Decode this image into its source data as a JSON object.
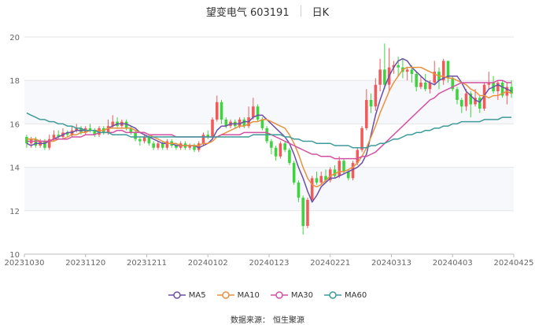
{
  "header": {
    "stock_name": "望变电气 603191",
    "period": "日K"
  },
  "source": {
    "label": "数据来源：",
    "value": "恒生聚源"
  },
  "colors": {
    "up": "#f15a5a",
    "down": "#3dd43d",
    "ma5": "#6c4fa6",
    "ma10": "#e8913e",
    "ma30": "#d450a2",
    "ma60": "#3f9a9a",
    "grid_band": "#f7f8fb",
    "axis": "#999999"
  },
  "chart_data": {
    "type": "candlestick",
    "x_tick_labels": [
      "20231030",
      "20231120",
      "20231211",
      "20240102",
      "20240123",
      "20240221",
      "20240313",
      "20240403",
      "20240425"
    ],
    "y_ticks": [
      10,
      12,
      14,
      16,
      18,
      20
    ],
    "ylim": [
      10,
      20
    ],
    "legend": [
      {
        "key": "ma5",
        "label": "MA5"
      },
      {
        "key": "ma10",
        "label": "MA10"
      },
      {
        "key": "ma30",
        "label": "MA30"
      },
      {
        "key": "ma60",
        "label": "MA60"
      }
    ],
    "candles": [
      [
        15.4,
        15.1,
        15.5,
        14.9
      ],
      [
        15.1,
        15.3,
        15.4,
        14.9
      ],
      [
        15.3,
        15.0,
        15.4,
        14.9
      ],
      [
        15.0,
        15.2,
        15.3,
        14.9
      ],
      [
        15.2,
        14.9,
        15.3,
        14.8
      ],
      [
        14.9,
        15.3,
        15.5,
        14.8
      ],
      [
        15.3,
        15.5,
        15.7,
        15.2
      ],
      [
        15.5,
        15.4,
        15.7,
        15.3
      ],
      [
        15.4,
        15.6,
        15.8,
        15.3
      ],
      [
        15.6,
        15.5,
        15.7,
        15.4
      ],
      [
        15.5,
        15.7,
        15.9,
        15.4
      ],
      [
        15.7,
        15.8,
        16.0,
        15.6
      ],
      [
        15.8,
        15.6,
        15.9,
        15.5
      ],
      [
        15.6,
        15.8,
        15.9,
        15.5
      ],
      [
        15.8,
        15.7,
        16.0,
        15.6
      ],
      [
        15.7,
        15.5,
        15.8,
        15.4
      ],
      [
        15.5,
        15.8,
        15.9,
        15.4
      ],
      [
        15.8,
        15.6,
        15.9,
        15.5
      ],
      [
        15.6,
        15.9,
        16.2,
        15.5
      ],
      [
        15.9,
        16.1,
        16.4,
        15.8
      ],
      [
        16.1,
        15.9,
        16.3,
        15.8
      ],
      [
        15.9,
        16.1,
        16.2,
        15.8
      ],
      [
        16.1,
        15.8,
        16.2,
        15.7
      ],
      [
        15.8,
        15.6,
        15.9,
        15.5
      ],
      [
        15.6,
        15.3,
        15.7,
        15.2
      ],
      [
        15.3,
        15.2,
        15.4,
        15.0
      ],
      [
        15.2,
        15.4,
        15.5,
        15.1
      ],
      [
        15.4,
        15.1,
        15.5,
        15.0
      ],
      [
        15.1,
        14.9,
        15.2,
        14.8
      ],
      [
        14.9,
        15.1,
        15.2,
        14.8
      ],
      [
        15.1,
        14.9,
        15.2,
        14.8
      ],
      [
        14.9,
        15.2,
        15.3,
        14.8
      ],
      [
        15.2,
        15.0,
        15.3,
        14.9
      ],
      [
        15.0,
        14.9,
        15.1,
        14.8
      ],
      [
        14.9,
        15.1,
        15.2,
        14.8
      ],
      [
        15.1,
        14.9,
        15.2,
        14.8
      ],
      [
        14.9,
        15.0,
        15.1,
        14.8
      ],
      [
        15.0,
        14.8,
        15.1,
        14.7
      ],
      [
        14.8,
        15.1,
        15.2,
        14.7
      ],
      [
        15.1,
        15.5,
        15.6,
        15.0
      ],
      [
        15.5,
        15.4,
        15.7,
        15.3
      ],
      [
        15.4,
        16.2,
        16.3,
        15.3
      ],
      [
        16.2,
        17.0,
        17.3,
        16.1
      ],
      [
        17.0,
        16.2,
        17.1,
        16.0
      ],
      [
        16.2,
        15.9,
        16.3,
        15.8
      ],
      [
        15.9,
        16.1,
        16.2,
        15.8
      ],
      [
        16.1,
        15.9,
        16.2,
        15.8
      ],
      [
        15.9,
        16.2,
        16.3,
        15.8
      ],
      [
        16.2,
        15.9,
        16.3,
        15.8
      ],
      [
        15.9,
        16.3,
        16.8,
        15.8
      ],
      [
        16.3,
        16.8,
        17.2,
        16.2
      ],
      [
        16.8,
        16.2,
        16.9,
        16.1
      ],
      [
        16.2,
        15.8,
        16.3,
        15.7
      ],
      [
        15.8,
        15.2,
        15.9,
        15.1
      ],
      [
        15.2,
        14.9,
        15.3,
        14.6
      ],
      [
        14.9,
        14.5,
        15.0,
        14.3
      ],
      [
        14.5,
        15.1,
        15.2,
        14.4
      ],
      [
        15.1,
        14.8,
        15.2,
        14.7
      ],
      [
        14.8,
        14.2,
        14.9,
        14.1
      ],
      [
        14.2,
        13.3,
        14.3,
        13.2
      ],
      [
        13.3,
        12.6,
        13.4,
        12.4
      ],
      [
        12.6,
        11.3,
        12.7,
        10.9
      ],
      [
        11.3,
        12.5,
        12.6,
        11.2
      ],
      [
        12.5,
        13.5,
        13.6,
        12.4
      ],
      [
        13.5,
        13.3,
        13.8,
        13.2
      ],
      [
        13.3,
        13.6,
        13.8,
        13.2
      ],
      [
        13.6,
        13.4,
        13.9,
        13.3
      ],
      [
        13.4,
        13.9,
        14.0,
        13.3
      ],
      [
        13.9,
        13.6,
        14.1,
        13.5
      ],
      [
        13.6,
        14.3,
        14.5,
        13.5
      ],
      [
        14.3,
        13.8,
        14.4,
        13.7
      ],
      [
        13.8,
        13.5,
        13.9,
        13.4
      ],
      [
        13.5,
        14.2,
        14.3,
        13.4
      ],
      [
        14.2,
        14.8,
        14.9,
        14.1
      ],
      [
        14.8,
        15.8,
        15.9,
        14.7
      ],
      [
        15.8,
        17.1,
        17.6,
        15.7
      ],
      [
        17.1,
        16.8,
        17.4,
        16.5
      ],
      [
        16.8,
        17.8,
        18.1,
        16.6
      ],
      [
        17.8,
        18.5,
        19.0,
        17.5
      ],
      [
        18.5,
        17.8,
        19.7,
        17.6
      ],
      [
        17.8,
        18.6,
        19.5,
        17.5
      ],
      [
        18.6,
        18.7,
        18.9,
        18.3
      ],
      [
        18.7,
        18.6,
        19.1,
        18.2
      ],
      [
        18.6,
        18.4,
        19.0,
        18.1
      ],
      [
        18.4,
        18.5,
        18.6,
        18.0
      ],
      [
        18.5,
        18.3,
        18.7,
        17.9
      ],
      [
        18.3,
        17.7,
        18.4,
        17.5
      ],
      [
        17.7,
        17.9,
        18.2,
        17.6
      ],
      [
        17.9,
        17.6,
        18.3,
        17.5
      ],
      [
        17.6,
        17.9,
        18.0,
        17.4
      ],
      [
        17.9,
        18.4,
        18.9,
        17.8
      ],
      [
        18.4,
        18.0,
        18.6,
        17.6
      ],
      [
        18.0,
        18.9,
        19.0,
        17.8
      ],
      [
        18.9,
        18.1,
        18.9,
        17.9
      ],
      [
        18.1,
        17.6,
        18.2,
        17.5
      ],
      [
        17.6,
        17.1,
        17.7,
        16.9
      ],
      [
        17.1,
        16.8,
        17.2,
        16.5
      ],
      [
        16.8,
        17.4,
        17.6,
        16.6
      ],
      [
        17.4,
        16.9,
        17.5,
        16.3
      ],
      [
        16.9,
        17.2,
        17.6,
        16.8
      ],
      [
        17.2,
        16.7,
        17.3,
        16.5
      ],
      [
        16.7,
        17.8,
        17.9,
        16.6
      ],
      [
        17.8,
        17.9,
        18.4,
        17.6
      ],
      [
        17.9,
        17.5,
        18.2,
        17.4
      ],
      [
        17.5,
        17.9,
        18.0,
        17.1
      ],
      [
        17.9,
        17.3,
        18.0,
        17.2
      ],
      [
        17.3,
        17.7,
        17.9,
        16.9
      ],
      [
        17.7,
        17.4,
        18.0,
        17.2
      ]
    ],
    "series": [
      {
        "key": "ma5",
        "name": "MA5",
        "values": [
          15.1,
          15.0,
          15.1,
          15.1,
          15.1,
          15.2,
          15.3,
          15.4,
          15.5,
          15.6,
          15.6,
          15.7,
          15.7,
          15.7,
          15.7,
          15.7,
          15.7,
          15.7,
          15.8,
          15.9,
          16.0,
          16.0,
          16.0,
          15.9,
          15.8,
          15.6,
          15.5,
          15.4,
          15.3,
          15.2,
          15.1,
          15.1,
          15.1,
          15.0,
          15.0,
          15.0,
          15.0,
          15.0,
          14.9,
          15.0,
          15.1,
          15.3,
          15.7,
          15.9,
          15.9,
          16.0,
          16.0,
          16.0,
          16.1,
          16.1,
          16.3,
          16.4,
          16.4,
          16.2,
          16.0,
          15.8,
          15.6,
          15.4,
          15.1,
          14.6,
          14.0,
          13.5,
          12.9,
          12.4,
          12.7,
          13.1,
          13.3,
          13.5,
          13.5,
          13.6,
          13.7,
          13.8,
          13.9,
          14.0,
          14.2,
          14.6,
          15.5,
          16.4,
          17.1,
          17.7,
          18.2,
          18.6,
          18.9,
          19.0,
          18.9,
          18.6,
          18.4,
          18.2,
          18.0,
          17.9,
          17.8,
          18.0,
          18.1,
          18.2,
          18.2,
          18.2,
          17.9,
          17.5,
          17.3,
          17.1,
          17.0,
          17.3,
          17.6,
          17.7,
          17.8,
          17.7,
          17.6,
          17.5
        ]
      },
      {
        "key": "ma10",
        "name": "MA10",
        "values": [
          15.3,
          15.3,
          15.3,
          15.2,
          15.2,
          15.2,
          15.2,
          15.3,
          15.3,
          15.4,
          15.5,
          15.5,
          15.6,
          15.6,
          15.7,
          15.7,
          15.7,
          15.7,
          15.8,
          15.8,
          15.8,
          15.8,
          15.8,
          15.8,
          15.7,
          15.6,
          15.6,
          15.5,
          15.4,
          15.3,
          15.2,
          15.1,
          15.1,
          15.1,
          15.0,
          15.0,
          15.0,
          15.0,
          15.0,
          15.1,
          15.1,
          15.2,
          15.4,
          15.5,
          15.6,
          15.7,
          15.8,
          15.9,
          15.9,
          16.0,
          16.1,
          16.1,
          16.2,
          16.2,
          16.1,
          16.0,
          15.9,
          15.8,
          15.5,
          15.1,
          14.6,
          14.0,
          13.5,
          13.2,
          13.1,
          13.2,
          13.4,
          13.6,
          13.7,
          13.8,
          13.8,
          13.9,
          14.0,
          14.2,
          14.5,
          14.9,
          15.4,
          15.9,
          16.5,
          17.0,
          17.5,
          17.9,
          18.2,
          18.5,
          18.6,
          18.6,
          18.6,
          18.6,
          18.5,
          18.4,
          18.3,
          18.2,
          18.2,
          18.1,
          18.1,
          18.0,
          17.9,
          17.8,
          17.6,
          17.5,
          17.3,
          17.3,
          17.2,
          17.3,
          17.3,
          17.4,
          17.5,
          17.4
        ]
      },
      {
        "key": "ma30",
        "name": "MA30",
        "values": [
          15.2,
          15.2,
          15.2,
          15.2,
          15.2,
          15.2,
          15.3,
          15.3,
          15.3,
          15.3,
          15.4,
          15.4,
          15.4,
          15.5,
          15.5,
          15.5,
          15.6,
          15.6,
          15.6,
          15.6,
          15.7,
          15.7,
          15.6,
          15.6,
          15.6,
          15.6,
          15.6,
          15.5,
          15.5,
          15.5,
          15.5,
          15.5,
          15.5,
          15.4,
          15.4,
          15.4,
          15.4,
          15.4,
          15.4,
          15.4,
          15.4,
          15.4,
          15.4,
          15.5,
          15.5,
          15.5,
          15.5,
          15.5,
          15.6,
          15.6,
          15.6,
          15.6,
          15.6,
          15.6,
          15.5,
          15.4,
          15.3,
          15.2,
          15.1,
          15.0,
          14.9,
          14.8,
          14.7,
          14.6,
          14.6,
          14.5,
          14.5,
          14.5,
          14.4,
          14.4,
          14.4,
          14.4,
          14.4,
          14.4,
          14.5,
          14.5,
          14.6,
          14.7,
          14.9,
          15.1,
          15.3,
          15.5,
          15.7,
          15.9,
          16.1,
          16.3,
          16.5,
          16.7,
          16.9,
          17.1,
          17.2,
          17.4,
          17.5,
          17.6,
          17.7,
          17.8,
          17.9,
          17.9,
          17.9,
          17.9,
          17.9,
          17.9,
          17.9,
          17.9,
          18.0,
          18.0,
          17.9,
          17.9
        ]
      },
      {
        "key": "ma60",
        "name": "MA60",
        "values": [
          16.5,
          16.4,
          16.3,
          16.2,
          16.2,
          16.1,
          16.1,
          16.0,
          16.0,
          15.9,
          15.9,
          15.8,
          15.8,
          15.7,
          15.7,
          15.7,
          15.6,
          15.6,
          15.6,
          15.5,
          15.5,
          15.5,
          15.5,
          15.4,
          15.4,
          15.4,
          15.4,
          15.4,
          15.4,
          15.4,
          15.4,
          15.4,
          15.4,
          15.4,
          15.4,
          15.4,
          15.4,
          15.4,
          15.4,
          15.4,
          15.4,
          15.4,
          15.4,
          15.4,
          15.4,
          15.4,
          15.4,
          15.4,
          15.4,
          15.4,
          15.5,
          15.5,
          15.5,
          15.5,
          15.5,
          15.5,
          15.5,
          15.4,
          15.4,
          15.3,
          15.3,
          15.2,
          15.2,
          15.2,
          15.1,
          15.1,
          15.1,
          15.1,
          15.0,
          15.0,
          15.0,
          15.0,
          14.9,
          14.9,
          14.9,
          14.9,
          15.0,
          15.0,
          15.1,
          15.1,
          15.2,
          15.3,
          15.3,
          15.4,
          15.5,
          15.5,
          15.6,
          15.6,
          15.7,
          15.7,
          15.8,
          15.8,
          15.9,
          15.9,
          16.0,
          16.0,
          16.1,
          16.1,
          16.1,
          16.1,
          16.1,
          16.2,
          16.2,
          16.2,
          16.2,
          16.3,
          16.3,
          16.3
        ]
      }
    ]
  }
}
